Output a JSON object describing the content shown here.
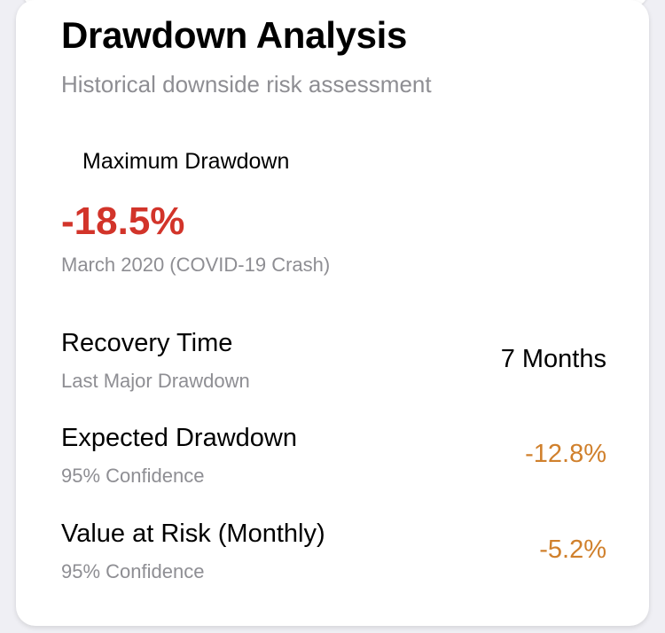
{
  "card": {
    "title": "Drawdown Analysis",
    "subtitle": "Historical downside risk assessment"
  },
  "max_drawdown": {
    "label": "Maximum Drawdown",
    "value": "-18.5%",
    "note": "March 2020 (COVID-19 Crash)",
    "value_color": "#d2342a"
  },
  "metrics": [
    {
      "label": "Recovery Time",
      "sub": "Last Major Drawdown",
      "value": "7 Months",
      "value_color": "#000000"
    },
    {
      "label": "Expected Drawdown",
      "sub": "95% Confidence",
      "value": "-12.8%",
      "value_color": "#d0802c"
    },
    {
      "label": "Value at Risk (Monthly)",
      "sub": "95% Confidence",
      "value": "-5.2%",
      "value_color": "#d0802c"
    }
  ]
}
